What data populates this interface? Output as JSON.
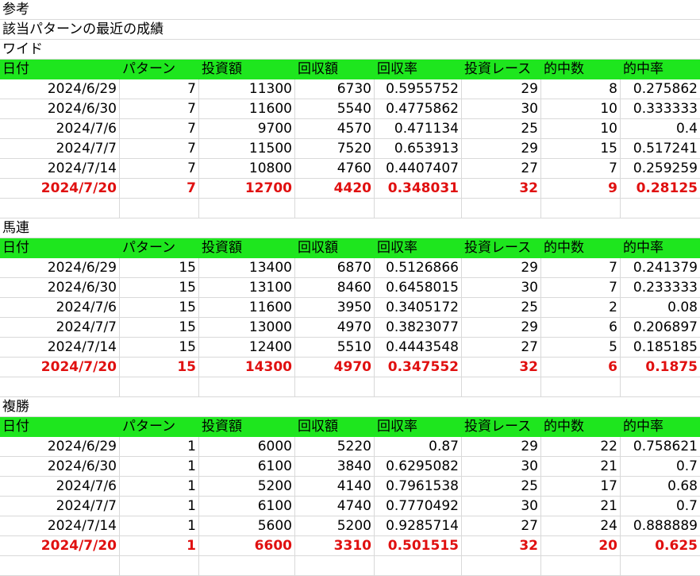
{
  "intro": {
    "line1": "参考",
    "line2": "該当パターンの最近の成績"
  },
  "columns": [
    "日付",
    "パターン",
    "投資額",
    "回収額",
    "回収率",
    "投資レース",
    "的中数",
    "的中率"
  ],
  "sections": [
    {
      "title": "ワイド",
      "rows": [
        [
          "2024/6/29",
          "7",
          "11300",
          "6730",
          "0.5955752",
          "29",
          "8",
          "0.275862"
        ],
        [
          "2024/6/30",
          "7",
          "11600",
          "5540",
          "0.4775862",
          "30",
          "10",
          "0.333333"
        ],
        [
          "2024/7/6",
          "7",
          "9700",
          "4570",
          "0.471134",
          "25",
          "10",
          "0.4"
        ],
        [
          "2024/7/7",
          "7",
          "11500",
          "7520",
          "0.653913",
          "29",
          "15",
          "0.517241"
        ],
        [
          "2024/7/14",
          "7",
          "10800",
          "4760",
          "0.4407407",
          "27",
          "7",
          "0.259259"
        ]
      ],
      "highlight": [
        "2024/7/20",
        "7",
        "12700",
        "4420",
        "0.348031",
        "32",
        "9",
        "0.28125"
      ]
    },
    {
      "title": "馬連",
      "rows": [
        [
          "2024/6/29",
          "15",
          "13400",
          "6870",
          "0.5126866",
          "29",
          "7",
          "0.241379"
        ],
        [
          "2024/6/30",
          "15",
          "13100",
          "8460",
          "0.6458015",
          "30",
          "7",
          "0.233333"
        ],
        [
          "2024/7/6",
          "15",
          "11600",
          "3950",
          "0.3405172",
          "25",
          "2",
          "0.08"
        ],
        [
          "2024/7/7",
          "15",
          "13000",
          "4970",
          "0.3823077",
          "29",
          "6",
          "0.206897"
        ],
        [
          "2024/7/14",
          "15",
          "12400",
          "5510",
          "0.4443548",
          "27",
          "5",
          "0.185185"
        ]
      ],
      "highlight": [
        "2024/7/20",
        "15",
        "14300",
        "4970",
        "0.347552",
        "32",
        "6",
        "0.1875"
      ]
    },
    {
      "title": "複勝",
      "rows": [
        [
          "2024/6/29",
          "1",
          "6000",
          "5220",
          "0.87",
          "29",
          "22",
          "0.758621"
        ],
        [
          "2024/6/30",
          "1",
          "6100",
          "3840",
          "0.6295082",
          "30",
          "21",
          "0.7"
        ],
        [
          "2024/7/6",
          "1",
          "5200",
          "4140",
          "0.7961538",
          "25",
          "17",
          "0.68"
        ],
        [
          "2024/7/7",
          "1",
          "6100",
          "4740",
          "0.7770492",
          "30",
          "21",
          "0.7"
        ],
        [
          "2024/7/14",
          "1",
          "5600",
          "5200",
          "0.9285714",
          "27",
          "24",
          "0.888889"
        ]
      ],
      "highlight": [
        "2024/7/20",
        "1",
        "6600",
        "3310",
        "0.501515",
        "32",
        "20",
        "0.625"
      ]
    }
  ],
  "colors": {
    "header_bg": "#1ee61e",
    "highlight_text": "#e01010",
    "gridline": "#d9d9d9"
  }
}
